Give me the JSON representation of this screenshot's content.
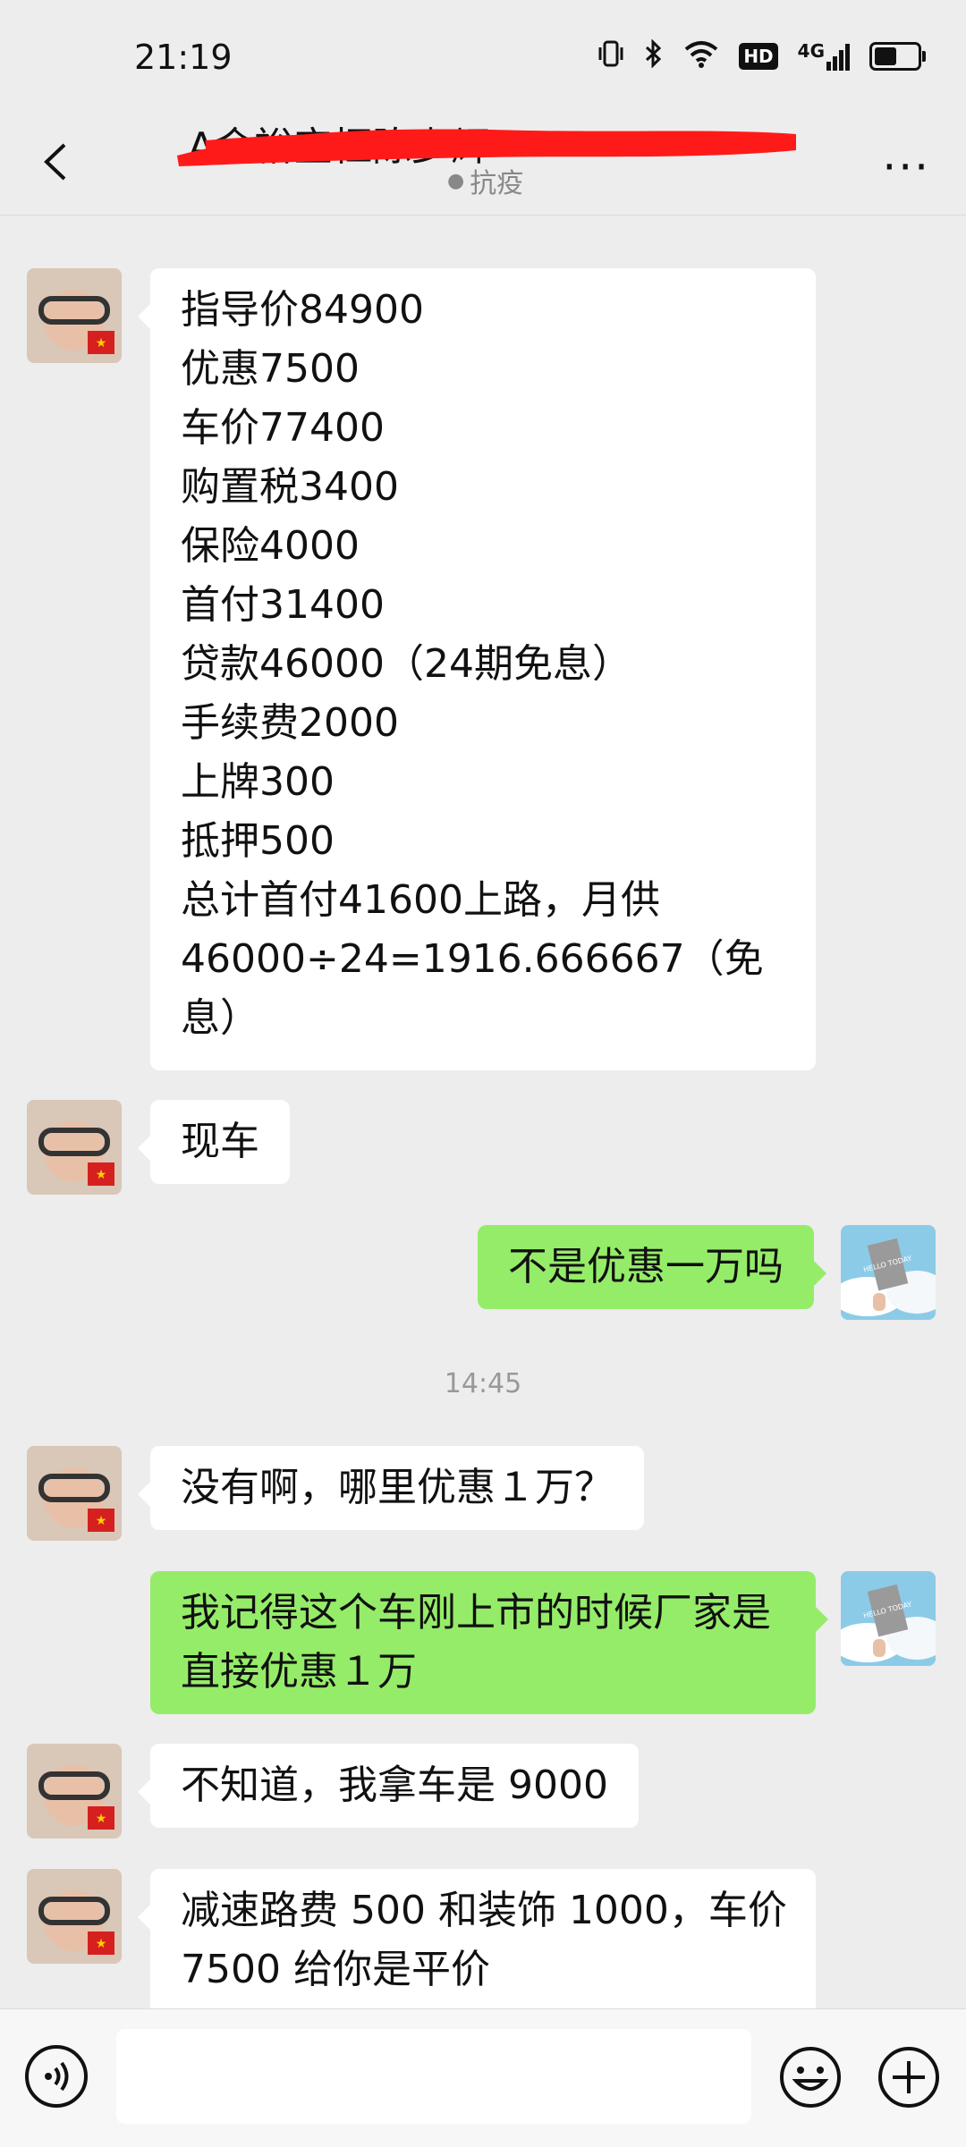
{
  "status_bar": {
    "time": "21:19",
    "icons": [
      "vibrate-icon",
      "bluetooth-icon",
      "wifi-icon",
      "hd-icon",
      "4g-signal-icon",
      "battery-icon"
    ],
    "hd_label": "HD",
    "network_label": "4G",
    "battery_level": 0.6
  },
  "header": {
    "title": "A金裕宝恒陈少辉",
    "subtitle": "抗疫",
    "title_redacted": true,
    "redaction_color": "#ff1a1a",
    "more_label": "···"
  },
  "chat": {
    "cut_timestamp": "14:45",
    "messages": [
      {
        "sender": "contact",
        "lines": [
          "指导价84900",
          "优惠7500",
          "车价77400",
          "购置税3400",
          "保险4000",
          "首付31400",
          "贷款46000（24期免息）",
          "手续费2000",
          "上牌300",
          "抵押500",
          "总计首付41600上路，月供",
          "46000÷24=1916.666667（免",
          "息）"
        ]
      },
      {
        "sender": "contact",
        "lines": [
          "现车"
        ]
      },
      {
        "sender": "me",
        "lines": [
          "不是优惠一万吗"
        ]
      },
      {
        "sender": "contact",
        "lines": [
          "没有啊，哪里优惠１万？"
        ]
      },
      {
        "sender": "me",
        "lines": [
          "我记得这个车刚上市的时候厂家是",
          "直接优惠１万"
        ]
      },
      {
        "sender": "contact",
        "lines": [
          "不知道，我拿车是 9000"
        ]
      },
      {
        "sender": "contact",
        "lines": [
          "减速路费 500 和装饰 1000，车价",
          "7500 给你是平价"
        ]
      }
    ],
    "timestamp_2": "14:45",
    "my_avatar_text": "HELLO TODAY"
  },
  "input_bar": {
    "placeholder": "",
    "icons": [
      "voice-icon",
      "emoji-icon",
      "plus-icon"
    ]
  },
  "colors": {
    "background": "#ededed",
    "incoming_bubble": "#ffffff",
    "outgoing_bubble": "#95ec69"
  }
}
